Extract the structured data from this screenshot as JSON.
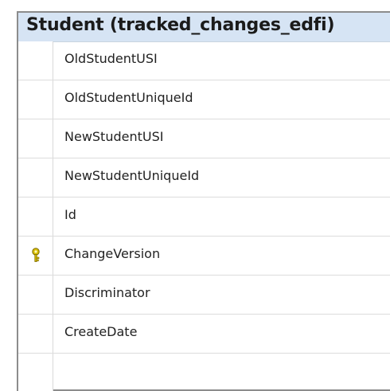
{
  "table": {
    "title": "Student (tracked_changes_edfi)",
    "columns": [
      {
        "name": "OldStudentUSI",
        "key": false
      },
      {
        "name": "OldStudentUniqueId",
        "key": false
      },
      {
        "name": "NewStudentUSI",
        "key": false
      },
      {
        "name": "NewStudentUniqueId",
        "key": false
      },
      {
        "name": "Id",
        "key": false
      },
      {
        "name": "ChangeVersion",
        "key": true,
        "icon": "key-icon"
      },
      {
        "name": "Discriminator",
        "key": false
      },
      {
        "name": "CreateDate",
        "key": false
      }
    ]
  },
  "colors": {
    "header_bg": "#d6e4f4",
    "border": "#8c8c8c",
    "key_icon": "#c9b100"
  }
}
